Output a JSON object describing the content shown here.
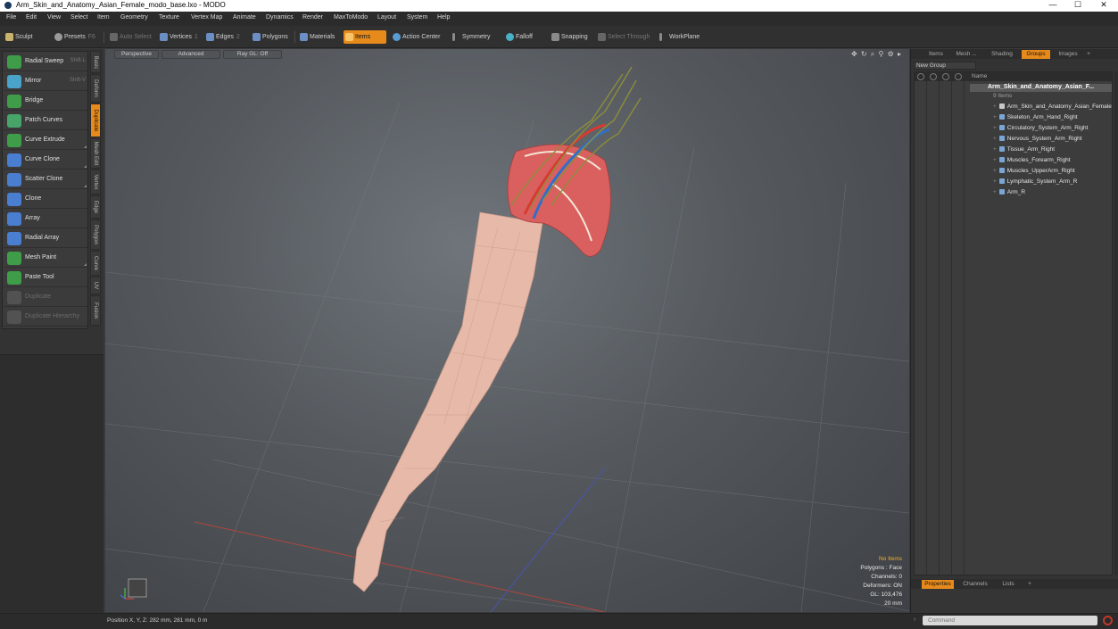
{
  "window": {
    "title": "Arm_Skin_and_Anatomy_Asian_Female_modo_base.lxo - MODO",
    "minimize": "—",
    "maximize": "☐",
    "close": "✕"
  },
  "menu": [
    "File",
    "Edit",
    "View",
    "Select",
    "Item",
    "Geometry",
    "Texture",
    "Vertex Map",
    "Animate",
    "Dynamics",
    "Render",
    "MaxToModo",
    "Layout",
    "System",
    "Help"
  ],
  "toolbar": {
    "sculpt": "Sculpt",
    "presets": "Presets",
    "presets_key": "F6",
    "auto_select": "Auto Select",
    "vertices": "Vertices",
    "vertices_count": "1",
    "edges": "Edges",
    "edges_count": "2",
    "polygons": "Polygons",
    "materials": "Materials",
    "items": "Items",
    "action_center": "Action Center",
    "symmetry": "Symmetry",
    "falloff": "Falloff",
    "snapping": "Snapping",
    "select_through": "Select Through",
    "workplane": "WorkPlane"
  },
  "tools": [
    {
      "label": "Radial Sweep",
      "key": "Shift-L",
      "color": "#3f9d4a"
    },
    {
      "label": "Mirror",
      "key": "Shift-V",
      "color": "#4aa3c8"
    },
    {
      "label": "Bridge",
      "key": "",
      "color": "#3f9d4a"
    },
    {
      "label": "Patch Curves",
      "key": "",
      "color": "#48a56a"
    },
    {
      "label": "Curve Extrude",
      "key": "",
      "color": "#3f9d4a"
    },
    {
      "label": "Curve Clone",
      "key": "",
      "color": "#4a7ed0"
    },
    {
      "label": "Scatter Clone",
      "key": "",
      "color": "#4a7ed0"
    },
    {
      "label": "Clone",
      "key": "",
      "color": "#4a7ed0"
    },
    {
      "label": "Array",
      "key": "",
      "color": "#4a7ed0"
    },
    {
      "label": "Radial Array",
      "key": "",
      "color": "#4a7ed0"
    },
    {
      "label": "Mesh Paint",
      "key": "",
      "color": "#3f9d4a"
    },
    {
      "label": "Paste Tool",
      "key": "",
      "color": "#3f9d4a"
    },
    {
      "label": "Duplicate",
      "key": "",
      "color": "#888888"
    },
    {
      "label": "Duplicate Hierarchy",
      "key": "",
      "color": "#888888"
    }
  ],
  "vtabs": [
    "Basic",
    "Deform",
    "Duplicate",
    "Mesh Edit",
    "Vertex",
    "Edge",
    "Polygon",
    "Curve",
    "UV",
    "Fusion"
  ],
  "viewport": {
    "view_mode": "Perspective",
    "shading": "Advanced",
    "raygl": "Ray GL: Off",
    "nav_icons": "✥ ↻ ⌕ ⚲ ⚙ ▸",
    "stats": {
      "no_items": "No Items",
      "polygons": "Polygons : Face",
      "channels": "Channels: 0",
      "deformers": "Deformers: ON",
      "gl": "GL: 103,476",
      "scale": "20 mm"
    }
  },
  "status": {
    "position": "Position X, Y, Z:   282 mm, 281 mm, 0 m",
    "command_placeholder": "Command",
    "arrow": "›"
  },
  "right_panel": {
    "tabs": [
      "Items",
      "Mesh ...",
      "Shading",
      "Groups",
      "Images",
      "+"
    ],
    "new_group": "New Group",
    "name_header": "Name",
    "group_title": "Arm_Skin_and_Anatomy_Asian_F...",
    "group_count": "9 Items",
    "items": [
      "Arm_Skin_and_Anatomy_Asian_Female",
      "Skeleton_Arm_Hand_Right",
      "Circulatory_System_Arm_Right",
      "Nervous_System_Arm_Right",
      "Tissue_Arm_Right",
      "Muscles_Forearm_Right",
      "Muscles_UpperArm_Right",
      "Lymphatic_System_Arm_R",
      "Arm_R"
    ],
    "bottom_tabs": [
      "Properties",
      "Channels",
      "Lists",
      "+"
    ]
  }
}
